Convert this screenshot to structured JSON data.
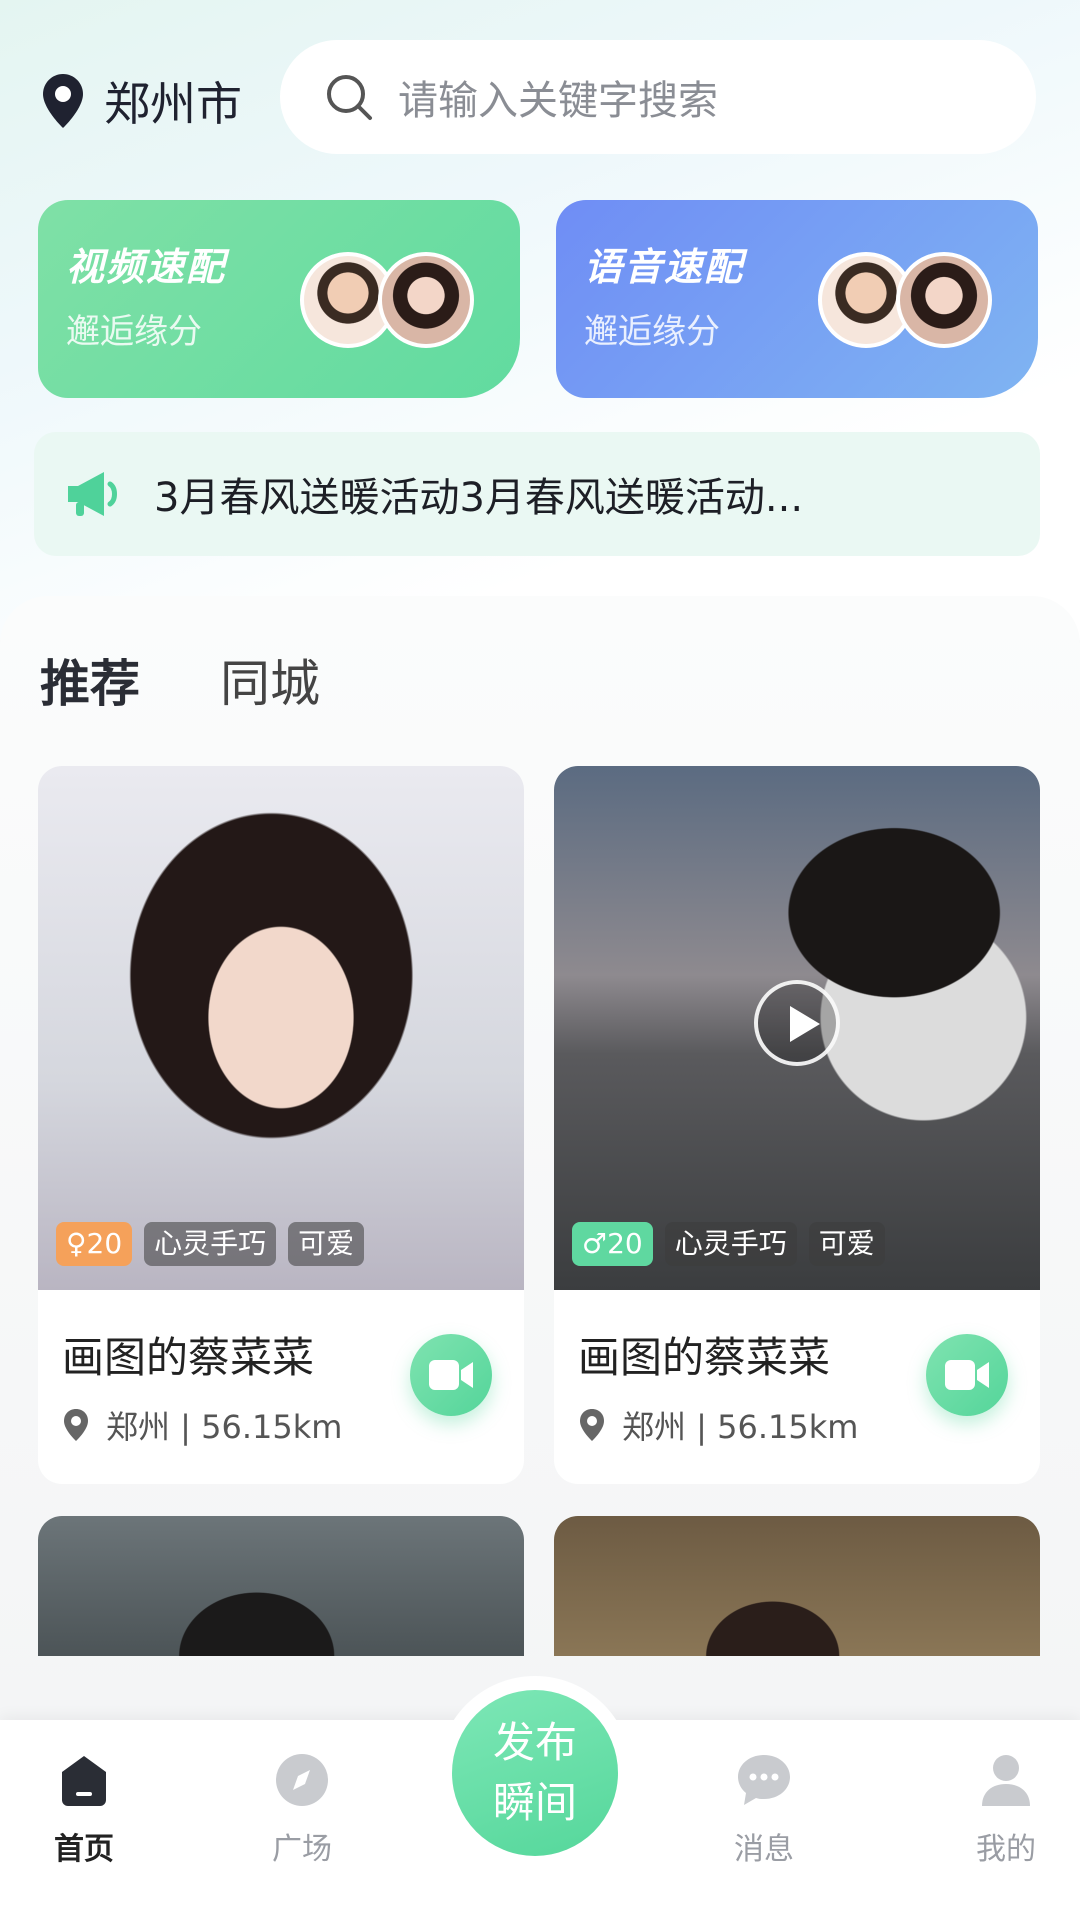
{
  "header": {
    "city": "郑州市",
    "search_placeholder": "请输入关键字搜索"
  },
  "match_cards": [
    {
      "title": "视频速配",
      "subtitle": "邂逅缘分"
    },
    {
      "title": "语音速配",
      "subtitle": "邂逅缘分"
    }
  ],
  "notice": {
    "text": "3月春风送暖活动3月春风送暖活动..."
  },
  "tabs": [
    {
      "label": "推荐",
      "active": true
    },
    {
      "label": "同城",
      "active": false
    }
  ],
  "cards": [
    {
      "gender_age": "♀20",
      "tags": [
        "心灵手巧",
        "可爱"
      ],
      "name": "画图的蔡菜菜",
      "city": "郑州",
      "distance": "56.15km",
      "location": "郑州 | 56.15km"
    },
    {
      "gender_age": "♂20",
      "tags": [
        "心灵手巧",
        "可爱"
      ],
      "name": "画图的蔡菜菜",
      "city": "郑州",
      "distance": "56.15km",
      "location": "郑州 | 56.15km"
    }
  ],
  "bottom_nav": {
    "home": "首页",
    "square": "广场",
    "publish": "发布瞬间",
    "messages": "消息",
    "me": "我的"
  },
  "colors": {
    "accent_green": "#5fd8a0",
    "voice_blue": "#6f8df5",
    "female_orange": "#f5a15a"
  }
}
